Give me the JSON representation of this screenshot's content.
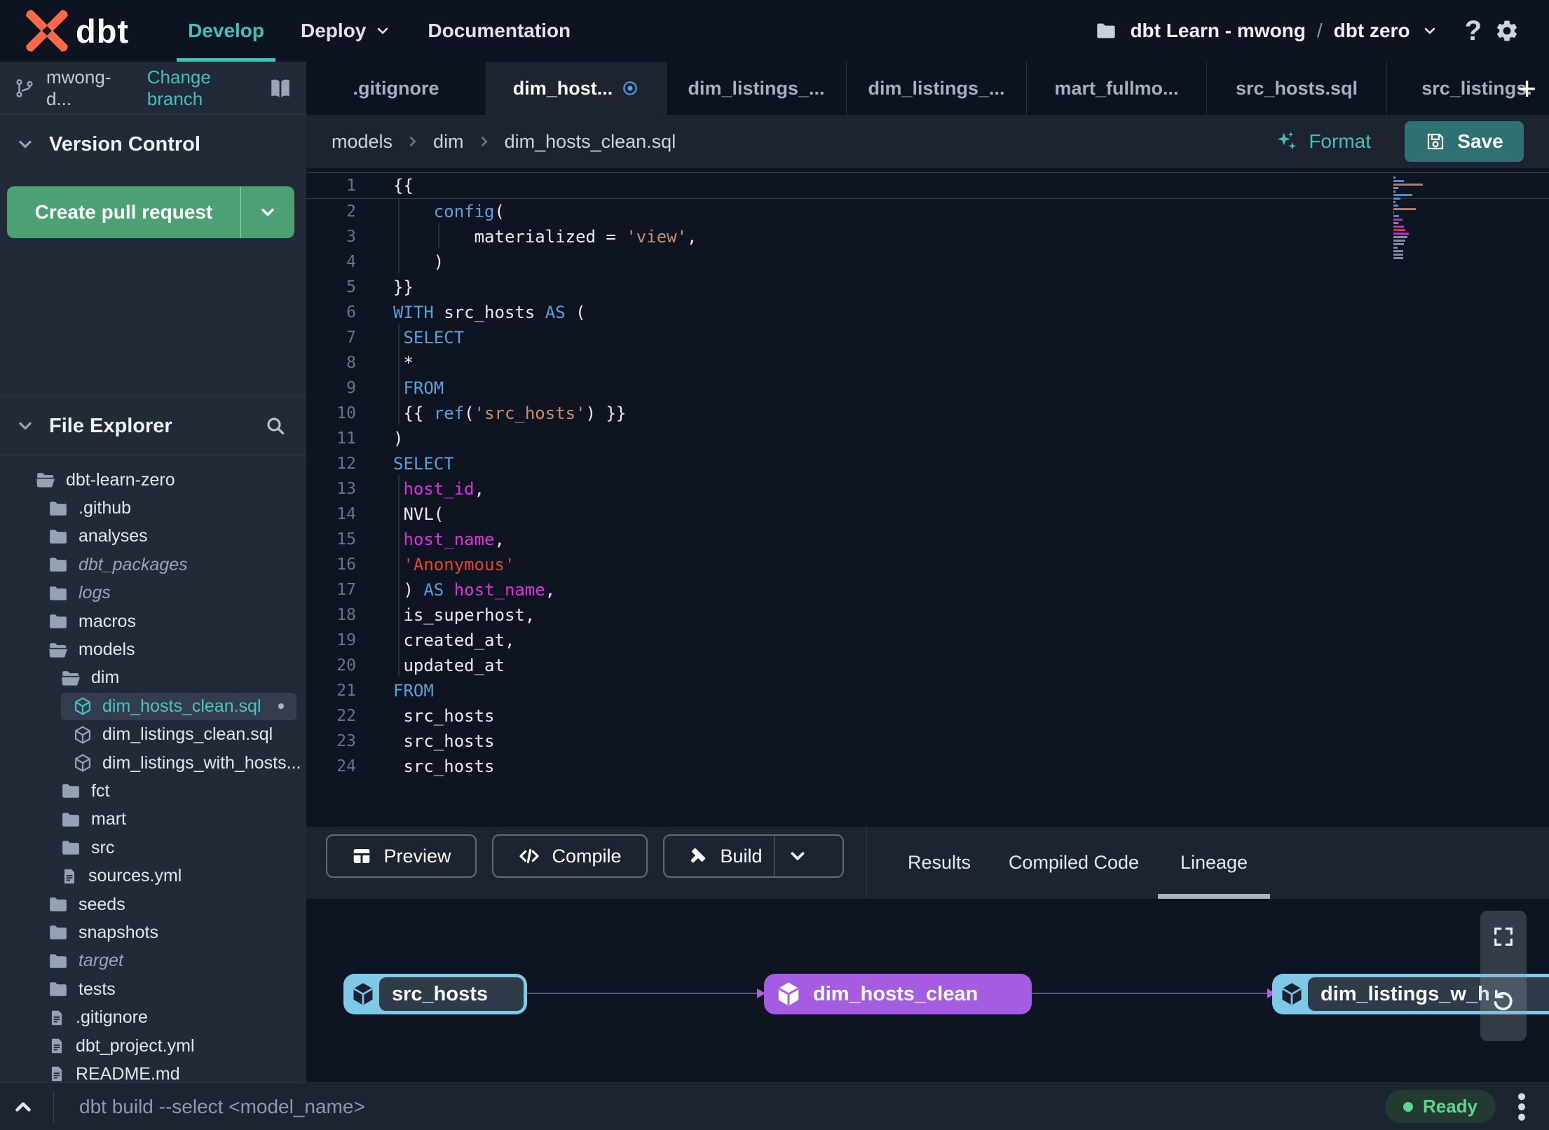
{
  "topnav": {
    "logo_text": "dbt",
    "items": [
      {
        "label": "Develop",
        "active": true
      },
      {
        "label": "Deploy",
        "has_dropdown": true
      },
      {
        "label": "Documentation"
      }
    ],
    "project": {
      "account": "dbt Learn - mwong",
      "separator": "/",
      "name": "dbt zero"
    },
    "accent_color": "#3fc2bb"
  },
  "sidebar": {
    "branch": {
      "name": "mwong-d...",
      "action": "Change branch"
    },
    "version_control": {
      "title": "Version Control",
      "create_pr_label": "Create pull request",
      "button_color": "#4ba173"
    },
    "file_explorer": {
      "title": "File Explorer",
      "items": [
        {
          "label": "dbt-learn-zero",
          "icon": "folder-open",
          "level": 0
        },
        {
          "label": ".github",
          "icon": "folder",
          "level": 1
        },
        {
          "label": "analyses",
          "icon": "folder",
          "level": 1
        },
        {
          "label": "dbt_packages",
          "icon": "folder",
          "level": 1,
          "italic": true
        },
        {
          "label": "logs",
          "icon": "folder",
          "level": 1,
          "italic": true
        },
        {
          "label": "macros",
          "icon": "folder",
          "level": 1
        },
        {
          "label": "models",
          "icon": "folder-open",
          "level": 1
        },
        {
          "label": "dim",
          "icon": "folder-open",
          "level": 2
        },
        {
          "label": "dim_hosts_clean.sql",
          "icon": "model",
          "level": 3,
          "selected": true,
          "dirty": true
        },
        {
          "label": "dim_listings_clean.sql",
          "icon": "model",
          "level": 3
        },
        {
          "label": "dim_listings_with_hosts...",
          "icon": "model",
          "level": 3
        },
        {
          "label": "fct",
          "icon": "folder",
          "level": 2
        },
        {
          "label": "mart",
          "icon": "folder",
          "level": 2
        },
        {
          "label": "src",
          "icon": "folder",
          "level": 2
        },
        {
          "label": "sources.yml",
          "icon": "file",
          "level": 2
        },
        {
          "label": "seeds",
          "icon": "folder",
          "level": 1
        },
        {
          "label": "snapshots",
          "icon": "folder",
          "level": 1
        },
        {
          "label": "target",
          "icon": "folder",
          "level": 1,
          "italic": true
        },
        {
          "label": "tests",
          "icon": "folder",
          "level": 1
        },
        {
          "label": ".gitignore",
          "icon": "file",
          "level": 1
        },
        {
          "label": "dbt_project.yml",
          "icon": "file",
          "level": 1
        },
        {
          "label": "README.md",
          "icon": "file",
          "level": 1
        }
      ]
    }
  },
  "tabs": {
    "items": [
      {
        "label": ".gitignore"
      },
      {
        "label": "dim_host...",
        "active": true,
        "dirty": true
      },
      {
        "label": "dim_listings_..."
      },
      {
        "label": "dim_listings_..."
      },
      {
        "label": "mart_fullmo..."
      },
      {
        "label": "src_hosts.sql"
      },
      {
        "label": "src_listings."
      }
    ],
    "new_tab": "+"
  },
  "editor": {
    "breadcrumb": [
      "models",
      "dim",
      "dim_hosts_clean.sql"
    ],
    "format_label": "Format",
    "save_label": "Save",
    "colors": {
      "keyword": "#58a2da",
      "string": "#c98e70",
      "string_alt": "#e5452f",
      "identifier": "#de30de",
      "plain": "#e8ecf2"
    },
    "code_lines": [
      {
        "num": 1,
        "current": true,
        "tokens": [
          {
            "c": "p",
            "t": "{{"
          }
        ]
      },
      {
        "num": 2,
        "tokens": [
          {
            "c": "p",
            "t": "    "
          },
          {
            "c": "kw",
            "t": "config"
          },
          {
            "c": "p",
            "t": "("
          }
        ]
      },
      {
        "num": 3,
        "tokens": [
          {
            "c": "p",
            "t": "        materialized = "
          },
          {
            "c": "str",
            "t": "'view'"
          },
          {
            "c": "p",
            "t": ","
          }
        ]
      },
      {
        "num": 4,
        "tokens": [
          {
            "c": "p",
            "t": "    )"
          }
        ]
      },
      {
        "num": 5,
        "tokens": [
          {
            "c": "p",
            "t": "}}"
          }
        ]
      },
      {
        "num": 6,
        "tokens": [
          {
            "c": "kw",
            "t": "WITH"
          },
          {
            "c": "p",
            "t": " src_hosts "
          },
          {
            "c": "kw",
            "t": "AS"
          },
          {
            "c": "p",
            "t": " ("
          }
        ]
      },
      {
        "num": 7,
        "tokens": [
          {
            "c": "p",
            "t": " "
          },
          {
            "c": "kw",
            "t": "SELECT"
          }
        ]
      },
      {
        "num": 8,
        "tokens": [
          {
            "c": "p",
            "t": " *"
          }
        ]
      },
      {
        "num": 9,
        "tokens": [
          {
            "c": "p",
            "t": " "
          },
          {
            "c": "kw",
            "t": "FROM"
          }
        ]
      },
      {
        "num": 10,
        "tokens": [
          {
            "c": "p",
            "t": " {{ "
          },
          {
            "c": "kw",
            "t": "ref"
          },
          {
            "c": "p",
            "t": "("
          },
          {
            "c": "str",
            "t": "'src_hosts'"
          },
          {
            "c": "p",
            "t": ") }}"
          }
        ]
      },
      {
        "num": 11,
        "tokens": [
          {
            "c": "p",
            "t": ")"
          }
        ]
      },
      {
        "num": 12,
        "tokens": [
          {
            "c": "kw",
            "t": "SELECT"
          }
        ]
      },
      {
        "num": 13,
        "tokens": [
          {
            "c": "p",
            "t": " "
          },
          {
            "c": "id",
            "t": "host_id"
          },
          {
            "c": "p",
            "t": ","
          }
        ]
      },
      {
        "num": 14,
        "tokens": [
          {
            "c": "p",
            "t": " NVL("
          }
        ]
      },
      {
        "num": 15,
        "tokens": [
          {
            "c": "p",
            "t": " "
          },
          {
            "c": "id",
            "t": "host_name"
          },
          {
            "c": "p",
            "t": ","
          }
        ]
      },
      {
        "num": 16,
        "tokens": [
          {
            "c": "p",
            "t": " "
          },
          {
            "c": "red",
            "t": "'Anonymous'"
          }
        ]
      },
      {
        "num": 17,
        "tokens": [
          {
            "c": "p",
            "t": " ) "
          },
          {
            "c": "kw",
            "t": "AS"
          },
          {
            "c": "p",
            "t": " "
          },
          {
            "c": "id",
            "t": "host_name"
          },
          {
            "c": "p",
            "t": ","
          }
        ]
      },
      {
        "num": 18,
        "tokens": [
          {
            "c": "p",
            "t": " is_superhost,"
          }
        ]
      },
      {
        "num": 19,
        "tokens": [
          {
            "c": "p",
            "t": " created_at,"
          }
        ]
      },
      {
        "num": 20,
        "tokens": [
          {
            "c": "p",
            "t": " updated_at"
          }
        ]
      },
      {
        "num": 21,
        "tokens": [
          {
            "c": "kw",
            "t": "FROM"
          }
        ]
      },
      {
        "num": 22,
        "tokens": [
          {
            "c": "p",
            "t": " src_hosts"
          }
        ]
      },
      {
        "num": 23,
        "tokens": [
          {
            "c": "p",
            "t": " src_hosts"
          }
        ]
      },
      {
        "num": 24,
        "tokens": [
          {
            "c": "p",
            "t": " src_hosts"
          }
        ]
      }
    ]
  },
  "bottom_panel": {
    "buttons": [
      {
        "label": "Preview",
        "icon": "table"
      },
      {
        "label": "Compile",
        "icon": "code"
      },
      {
        "label": "Build",
        "icon": "hammer",
        "split": true
      }
    ],
    "tabs": [
      {
        "label": "Results"
      },
      {
        "label": "Compiled Code"
      },
      {
        "label": "Lineage",
        "active": true
      }
    ]
  },
  "lineage": {
    "nodes": [
      {
        "label": "src_hosts",
        "type": "source"
      },
      {
        "label": "dim_hosts_clean",
        "type": "model"
      },
      {
        "label": "dim_listings_w_h",
        "type": "source"
      }
    ],
    "colors": {
      "source": "#7ec9e8",
      "model": "#a45ce0"
    }
  },
  "command_bar": {
    "command": "dbt build --select <model_name>",
    "status": "Ready"
  }
}
